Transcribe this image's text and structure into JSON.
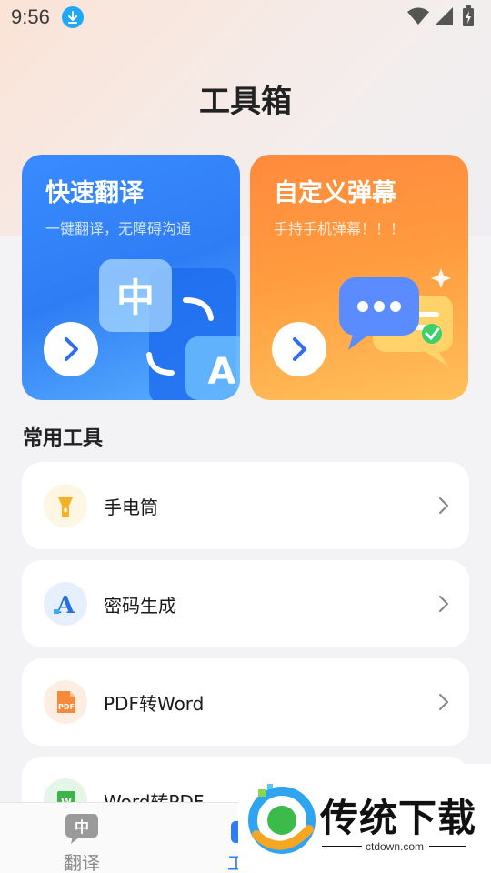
{
  "status_bar": {
    "time": "9:56",
    "icons": [
      "download-icon",
      "wifi-icon",
      "signal-icon",
      "battery-icon"
    ]
  },
  "page": {
    "title": "工具箱"
  },
  "feature_cards": [
    {
      "title": "快速翻译",
      "subtitle": "一键翻译，无障碍沟通",
      "color": "#2f7df4"
    },
    {
      "title": "自定义弹幕",
      "subtitle": "手持手机弹幕！！！",
      "color": "#ff9a3c"
    }
  ],
  "section": {
    "title": "常用工具"
  },
  "tools": [
    {
      "label": "手电筒",
      "icon": "flashlight-icon"
    },
    {
      "label": "密码生成",
      "icon": "password-icon"
    },
    {
      "label": "PDF转Word",
      "icon": "pdf-icon"
    },
    {
      "label": "Word转PDF",
      "icon": "word-icon"
    }
  ],
  "bottom_nav": [
    {
      "label": "翻译",
      "icon_text": "中",
      "active": false
    },
    {
      "label": "工具",
      "active": true
    }
  ],
  "watermark": {
    "brand": "传统下载",
    "url": "ctdown.com"
  },
  "colors": {
    "accent": "#2f7df4",
    "orange": "#ff9a3c",
    "background": "#f3f3f5"
  }
}
